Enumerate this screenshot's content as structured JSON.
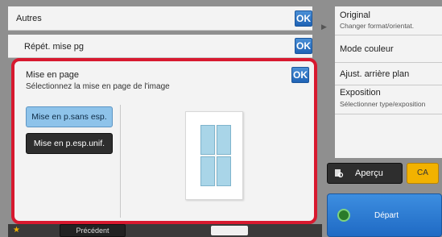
{
  "rows": {
    "autres": {
      "label": "Autres",
      "ok": "OK"
    },
    "repet": {
      "label": "Répét. mise pg",
      "ok": "OK"
    }
  },
  "dialog": {
    "title": "Mise en page",
    "subtitle": "Sélectionnez la mise en page de l'image",
    "ok": "OK",
    "options": [
      {
        "label": "Mise en p.sans esp.",
        "selected": true
      },
      {
        "label": "Mise en p.esp.unif.",
        "selected": false
      }
    ],
    "preview_icon": "four-page-layout-icon"
  },
  "bottom": {
    "previous_label": "Précédent"
  },
  "right_panel": {
    "items": [
      {
        "label": "Original",
        "sub": "Changer format/orientat."
      },
      {
        "label": "Mode couleur",
        "sub": ""
      },
      {
        "label": "Ajust. arrière plan",
        "sub": ""
      },
      {
        "label": "Exposition",
        "sub": "Sélectionner type/exposition"
      }
    ]
  },
  "actions": {
    "apercu": "Aperçu",
    "ca": "CA",
    "depart": "Départ"
  },
  "colors": {
    "accent_blue": "#1f63b5",
    "highlight_red": "#d7192f",
    "selected_option": "#8ec3ea",
    "ca_yellow": "#f2b200"
  }
}
